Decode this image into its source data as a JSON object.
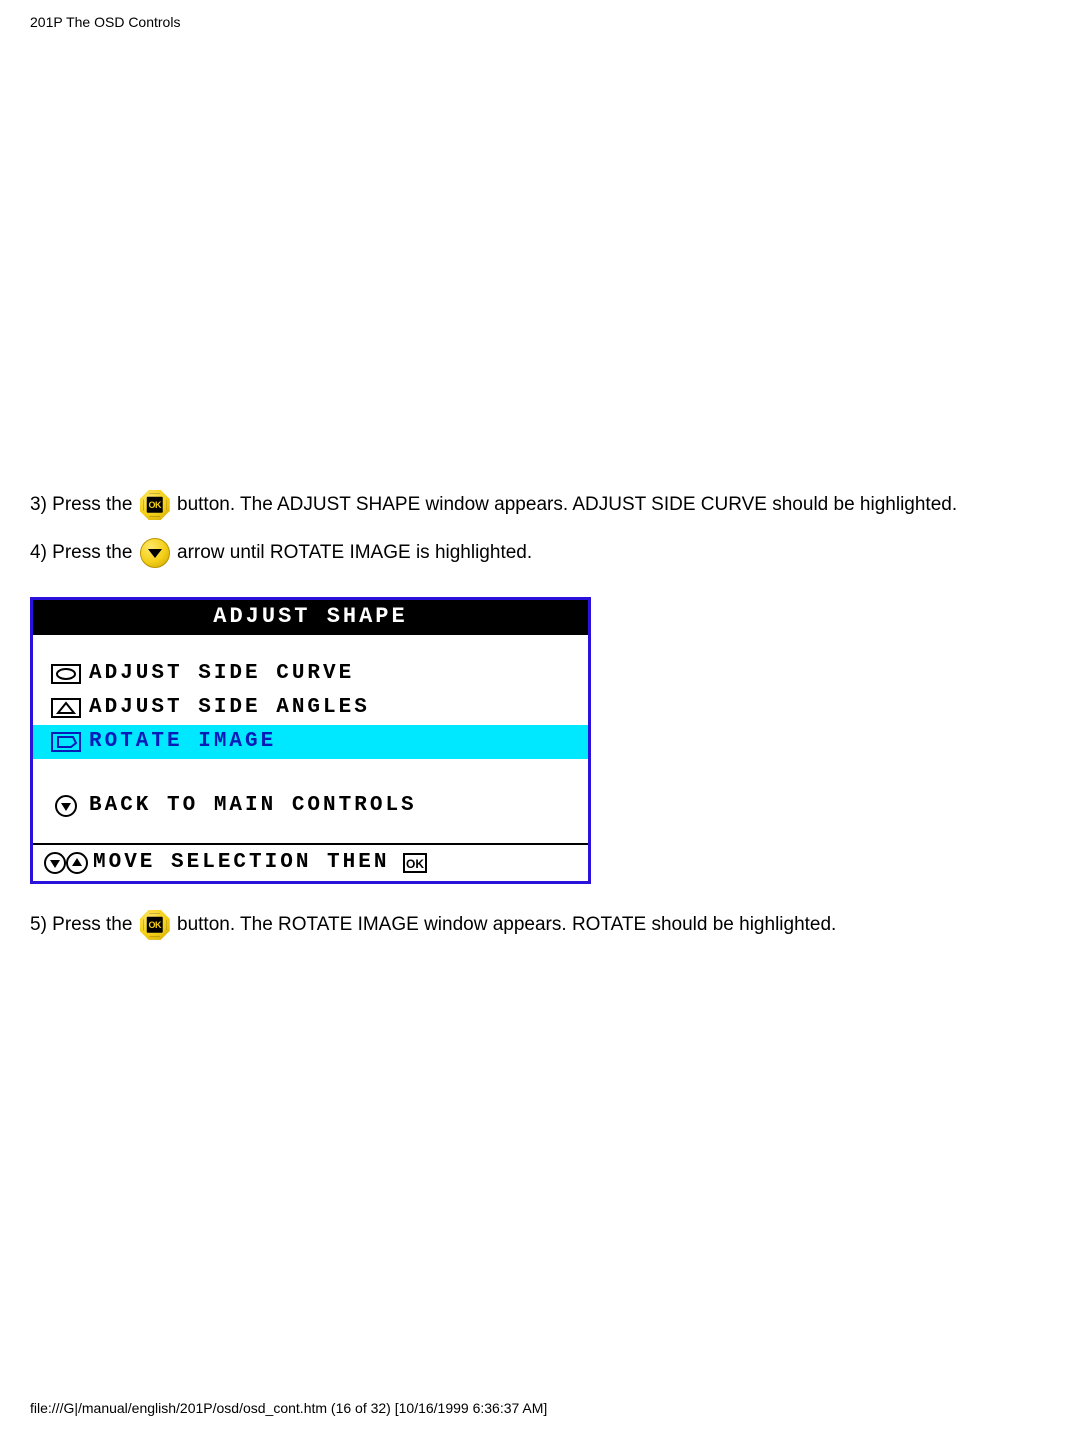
{
  "header": "201P The OSD Controls",
  "step3": {
    "prefix": "3) Press the ",
    "suffix": " button. The ADJUST SHAPE window appears. ADJUST SIDE CURVE should be highlighted."
  },
  "step4": {
    "prefix": "4) Press the ",
    "suffix": " arrow until ROTATE IMAGE is highlighted."
  },
  "osd": {
    "title": "ADJUST SHAPE",
    "items": [
      {
        "label": "ADJUST SIDE CURVE"
      },
      {
        "label": "ADJUST SIDE ANGLES"
      },
      {
        "label": "ROTATE IMAGE",
        "highlight": true
      }
    ],
    "back_label": "BACK TO MAIN CONTROLS",
    "footer_label": "MOVE SELECTION THEN"
  },
  "step5": {
    "prefix": "5) Press the ",
    "suffix": " button. The ROTATE IMAGE window appears. ROTATE should be highlighted."
  },
  "footer": "file:///G|/manual/english/201P/osd/osd_cont.htm (16 of 32) [10/16/1999 6:36:37 AM]"
}
